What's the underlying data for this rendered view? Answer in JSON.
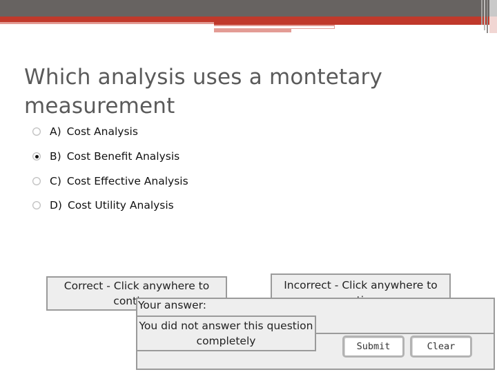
{
  "question": {
    "title": "Which analysis uses a montetary measurement"
  },
  "options": [
    {
      "letter": "A)",
      "label": "Cost Analysis",
      "selected": false
    },
    {
      "letter": "B)",
      "label": "Cost Benefit Analysis",
      "selected": true
    },
    {
      "letter": "C)",
      "label": "Cost Effective Analysis",
      "selected": false
    },
    {
      "letter": "D)",
      "label": "Cost Utility Analysis",
      "selected": false
    }
  ],
  "feedback": {
    "correct": "Correct - Click anywhere to continue",
    "incorrect": "Incorrect - Click anywhere to continue"
  },
  "answer_panel": {
    "label": "Your answer:",
    "message": "You did not answer this question completely"
  },
  "buttons": {
    "submit": "Submit",
    "clear": "Clear"
  },
  "colors": {
    "header_gray": "#676361",
    "accent_red": "#c0392b",
    "accent_pink": "#e39c95",
    "panel_bg": "#eeeeee",
    "panel_border": "#9a9a9a"
  }
}
